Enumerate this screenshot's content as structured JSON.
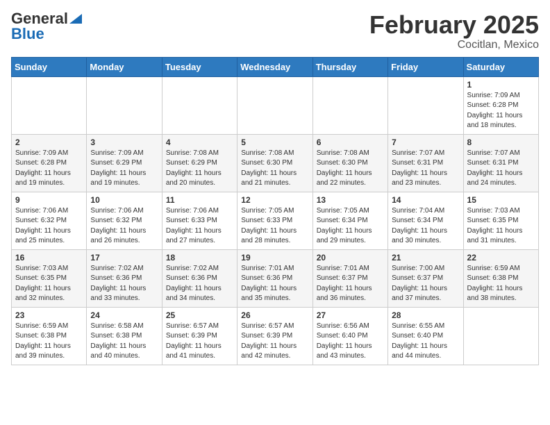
{
  "header": {
    "logo_general": "General",
    "logo_blue": "Blue",
    "month": "February 2025",
    "location": "Cocitlan, Mexico"
  },
  "weekdays": [
    "Sunday",
    "Monday",
    "Tuesday",
    "Wednesday",
    "Thursday",
    "Friday",
    "Saturday"
  ],
  "weeks": [
    [
      {
        "day": "",
        "info": ""
      },
      {
        "day": "",
        "info": ""
      },
      {
        "day": "",
        "info": ""
      },
      {
        "day": "",
        "info": ""
      },
      {
        "day": "",
        "info": ""
      },
      {
        "day": "",
        "info": ""
      },
      {
        "day": "1",
        "info": "Sunrise: 7:09 AM\nSunset: 6:28 PM\nDaylight: 11 hours\nand 18 minutes."
      }
    ],
    [
      {
        "day": "2",
        "info": "Sunrise: 7:09 AM\nSunset: 6:28 PM\nDaylight: 11 hours\nand 19 minutes."
      },
      {
        "day": "3",
        "info": "Sunrise: 7:09 AM\nSunset: 6:29 PM\nDaylight: 11 hours\nand 19 minutes."
      },
      {
        "day": "4",
        "info": "Sunrise: 7:08 AM\nSunset: 6:29 PM\nDaylight: 11 hours\nand 20 minutes."
      },
      {
        "day": "5",
        "info": "Sunrise: 7:08 AM\nSunset: 6:30 PM\nDaylight: 11 hours\nand 21 minutes."
      },
      {
        "day": "6",
        "info": "Sunrise: 7:08 AM\nSunset: 6:30 PM\nDaylight: 11 hours\nand 22 minutes."
      },
      {
        "day": "7",
        "info": "Sunrise: 7:07 AM\nSunset: 6:31 PM\nDaylight: 11 hours\nand 23 minutes."
      },
      {
        "day": "8",
        "info": "Sunrise: 7:07 AM\nSunset: 6:31 PM\nDaylight: 11 hours\nand 24 minutes."
      }
    ],
    [
      {
        "day": "9",
        "info": "Sunrise: 7:06 AM\nSunset: 6:32 PM\nDaylight: 11 hours\nand 25 minutes."
      },
      {
        "day": "10",
        "info": "Sunrise: 7:06 AM\nSunset: 6:32 PM\nDaylight: 11 hours\nand 26 minutes."
      },
      {
        "day": "11",
        "info": "Sunrise: 7:06 AM\nSunset: 6:33 PM\nDaylight: 11 hours\nand 27 minutes."
      },
      {
        "day": "12",
        "info": "Sunrise: 7:05 AM\nSunset: 6:33 PM\nDaylight: 11 hours\nand 28 minutes."
      },
      {
        "day": "13",
        "info": "Sunrise: 7:05 AM\nSunset: 6:34 PM\nDaylight: 11 hours\nand 29 minutes."
      },
      {
        "day": "14",
        "info": "Sunrise: 7:04 AM\nSunset: 6:34 PM\nDaylight: 11 hours\nand 30 minutes."
      },
      {
        "day": "15",
        "info": "Sunrise: 7:03 AM\nSunset: 6:35 PM\nDaylight: 11 hours\nand 31 minutes."
      }
    ],
    [
      {
        "day": "16",
        "info": "Sunrise: 7:03 AM\nSunset: 6:35 PM\nDaylight: 11 hours\nand 32 minutes."
      },
      {
        "day": "17",
        "info": "Sunrise: 7:02 AM\nSunset: 6:36 PM\nDaylight: 11 hours\nand 33 minutes."
      },
      {
        "day": "18",
        "info": "Sunrise: 7:02 AM\nSunset: 6:36 PM\nDaylight: 11 hours\nand 34 minutes."
      },
      {
        "day": "19",
        "info": "Sunrise: 7:01 AM\nSunset: 6:36 PM\nDaylight: 11 hours\nand 35 minutes."
      },
      {
        "day": "20",
        "info": "Sunrise: 7:01 AM\nSunset: 6:37 PM\nDaylight: 11 hours\nand 36 minutes."
      },
      {
        "day": "21",
        "info": "Sunrise: 7:00 AM\nSunset: 6:37 PM\nDaylight: 11 hours\nand 37 minutes."
      },
      {
        "day": "22",
        "info": "Sunrise: 6:59 AM\nSunset: 6:38 PM\nDaylight: 11 hours\nand 38 minutes."
      }
    ],
    [
      {
        "day": "23",
        "info": "Sunrise: 6:59 AM\nSunset: 6:38 PM\nDaylight: 11 hours\nand 39 minutes."
      },
      {
        "day": "24",
        "info": "Sunrise: 6:58 AM\nSunset: 6:38 PM\nDaylight: 11 hours\nand 40 minutes."
      },
      {
        "day": "25",
        "info": "Sunrise: 6:57 AM\nSunset: 6:39 PM\nDaylight: 11 hours\nand 41 minutes."
      },
      {
        "day": "26",
        "info": "Sunrise: 6:57 AM\nSunset: 6:39 PM\nDaylight: 11 hours\nand 42 minutes."
      },
      {
        "day": "27",
        "info": "Sunrise: 6:56 AM\nSunset: 6:40 PM\nDaylight: 11 hours\nand 43 minutes."
      },
      {
        "day": "28",
        "info": "Sunrise: 6:55 AM\nSunset: 6:40 PM\nDaylight: 11 hours\nand 44 minutes."
      },
      {
        "day": "",
        "info": ""
      }
    ]
  ]
}
